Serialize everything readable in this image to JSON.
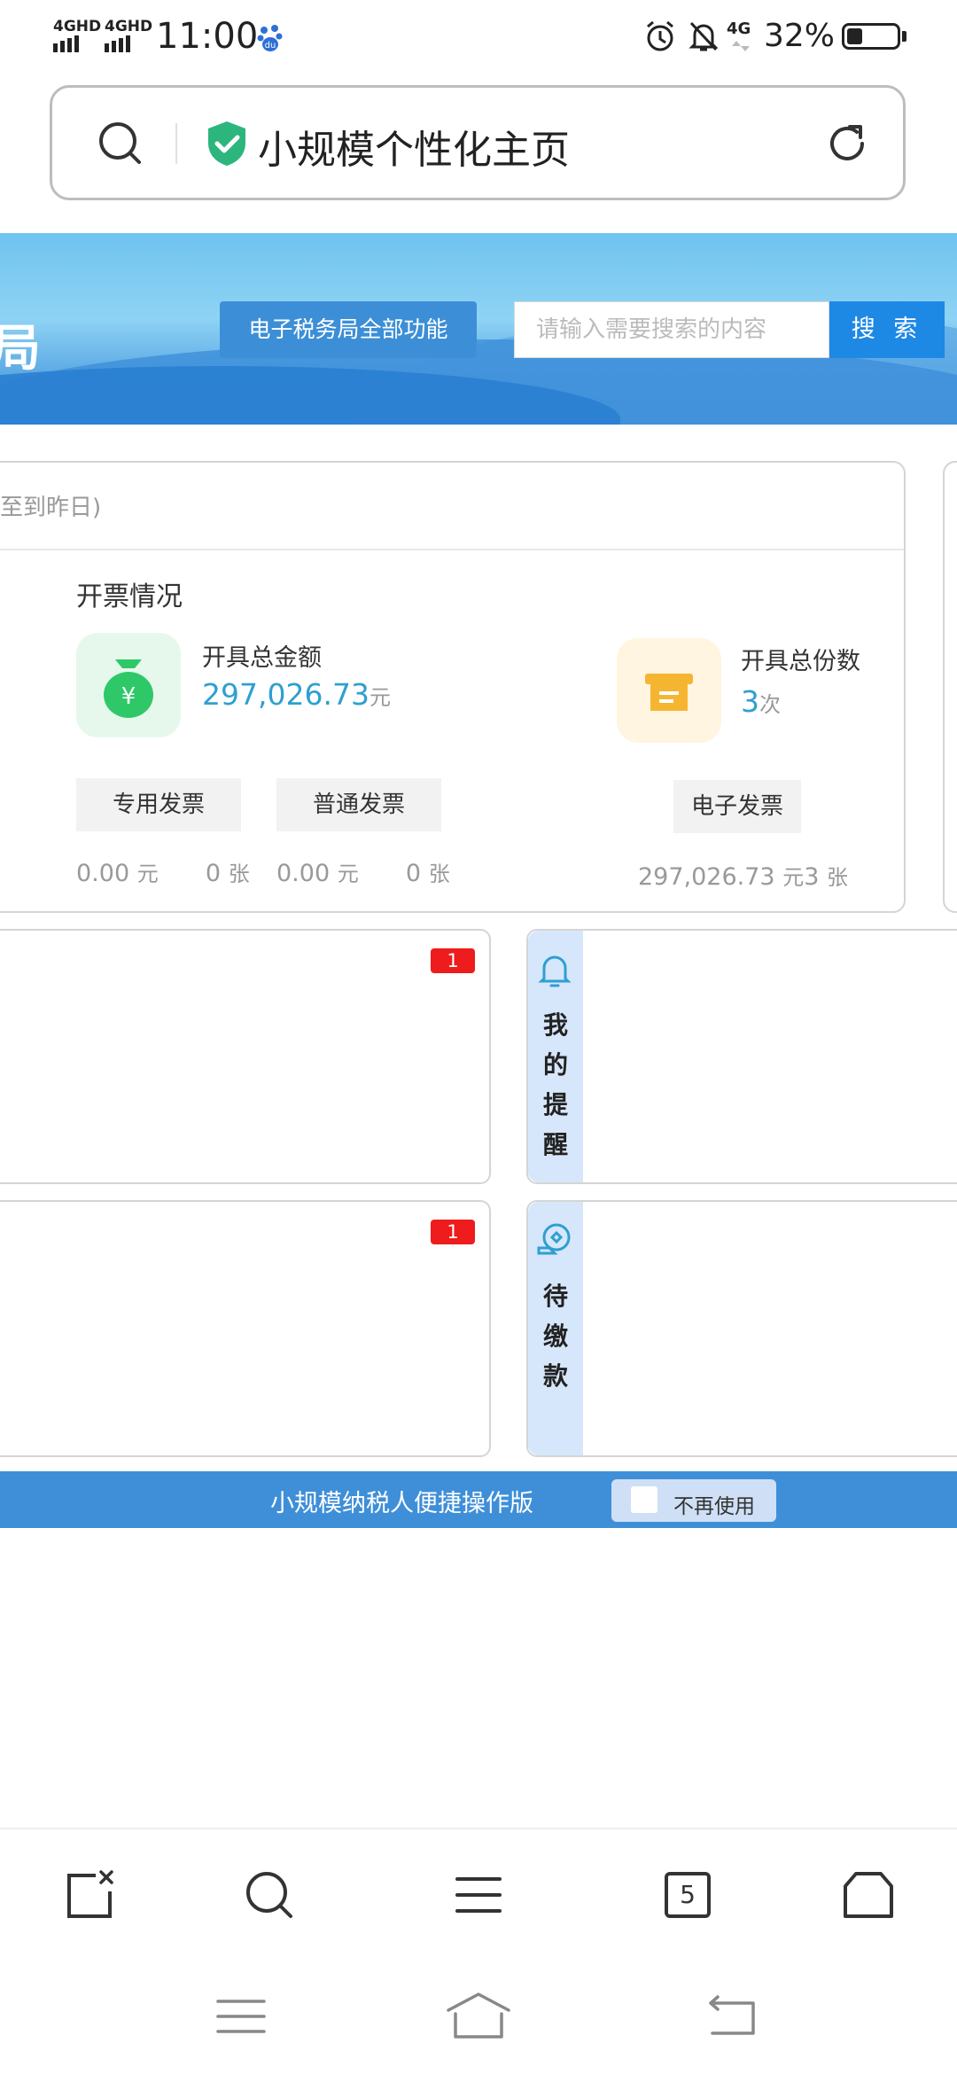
{
  "status_bar": {
    "signal1": "4GHD",
    "signal2": "4GHD",
    "time": "11:00",
    "network": "4G",
    "battery": "32%",
    "battery_level": 0.32
  },
  "address_bar": {
    "title": "小规模个性化主页"
  },
  "banner": {
    "all_functions_label": "电子税务局全部功能",
    "search_placeholder": "请输入需要搜索的内容",
    "search_button": "搜 索",
    "edge_char": "局"
  },
  "invoice_card": {
    "header_fragment": "至到昨日)",
    "section_title": "开票情况",
    "total_amount_label": "开具总金额",
    "total_amount_value": "297,026.73",
    "total_amount_unit": "元",
    "total_count_label": "开具总份数",
    "total_count_value": "3",
    "total_count_unit": "次",
    "tabs": [
      {
        "label": "专用发票",
        "amount": "0.00",
        "amount_unit": "元",
        "count": "0",
        "count_unit": "张"
      },
      {
        "label": "普通发票",
        "amount": "0.00",
        "amount_unit": "元",
        "count": "0",
        "count_unit": "张"
      },
      {
        "label": "电子发票",
        "amount": "297,026.73",
        "amount_unit": "元",
        "count": "3",
        "count_unit": "张"
      }
    ]
  },
  "tiles": {
    "badge1": "1",
    "badge2": "1",
    "reminder_label": [
      "我",
      "的",
      "提",
      "醒"
    ],
    "payment_label": [
      "待",
      "缴",
      "款"
    ]
  },
  "footer_bar": {
    "title": "小规模纳税人便捷操作版",
    "no_use_label": "不再使用"
  },
  "browser_nav": {
    "tab_count": "5",
    "icons": [
      "close-tab-icon",
      "search-icon",
      "menu-icon",
      "tabs-icon",
      "home-icon"
    ]
  },
  "system_nav": {
    "icons": [
      "menu-icon",
      "home-icon",
      "back-icon"
    ]
  },
  "colors": {
    "accent": "#1e88e5",
    "amount": "#2f9fd0",
    "badge": "#ee1c1c",
    "green_icon": "#2fc868",
    "yellow_icon": "#f6b531"
  }
}
